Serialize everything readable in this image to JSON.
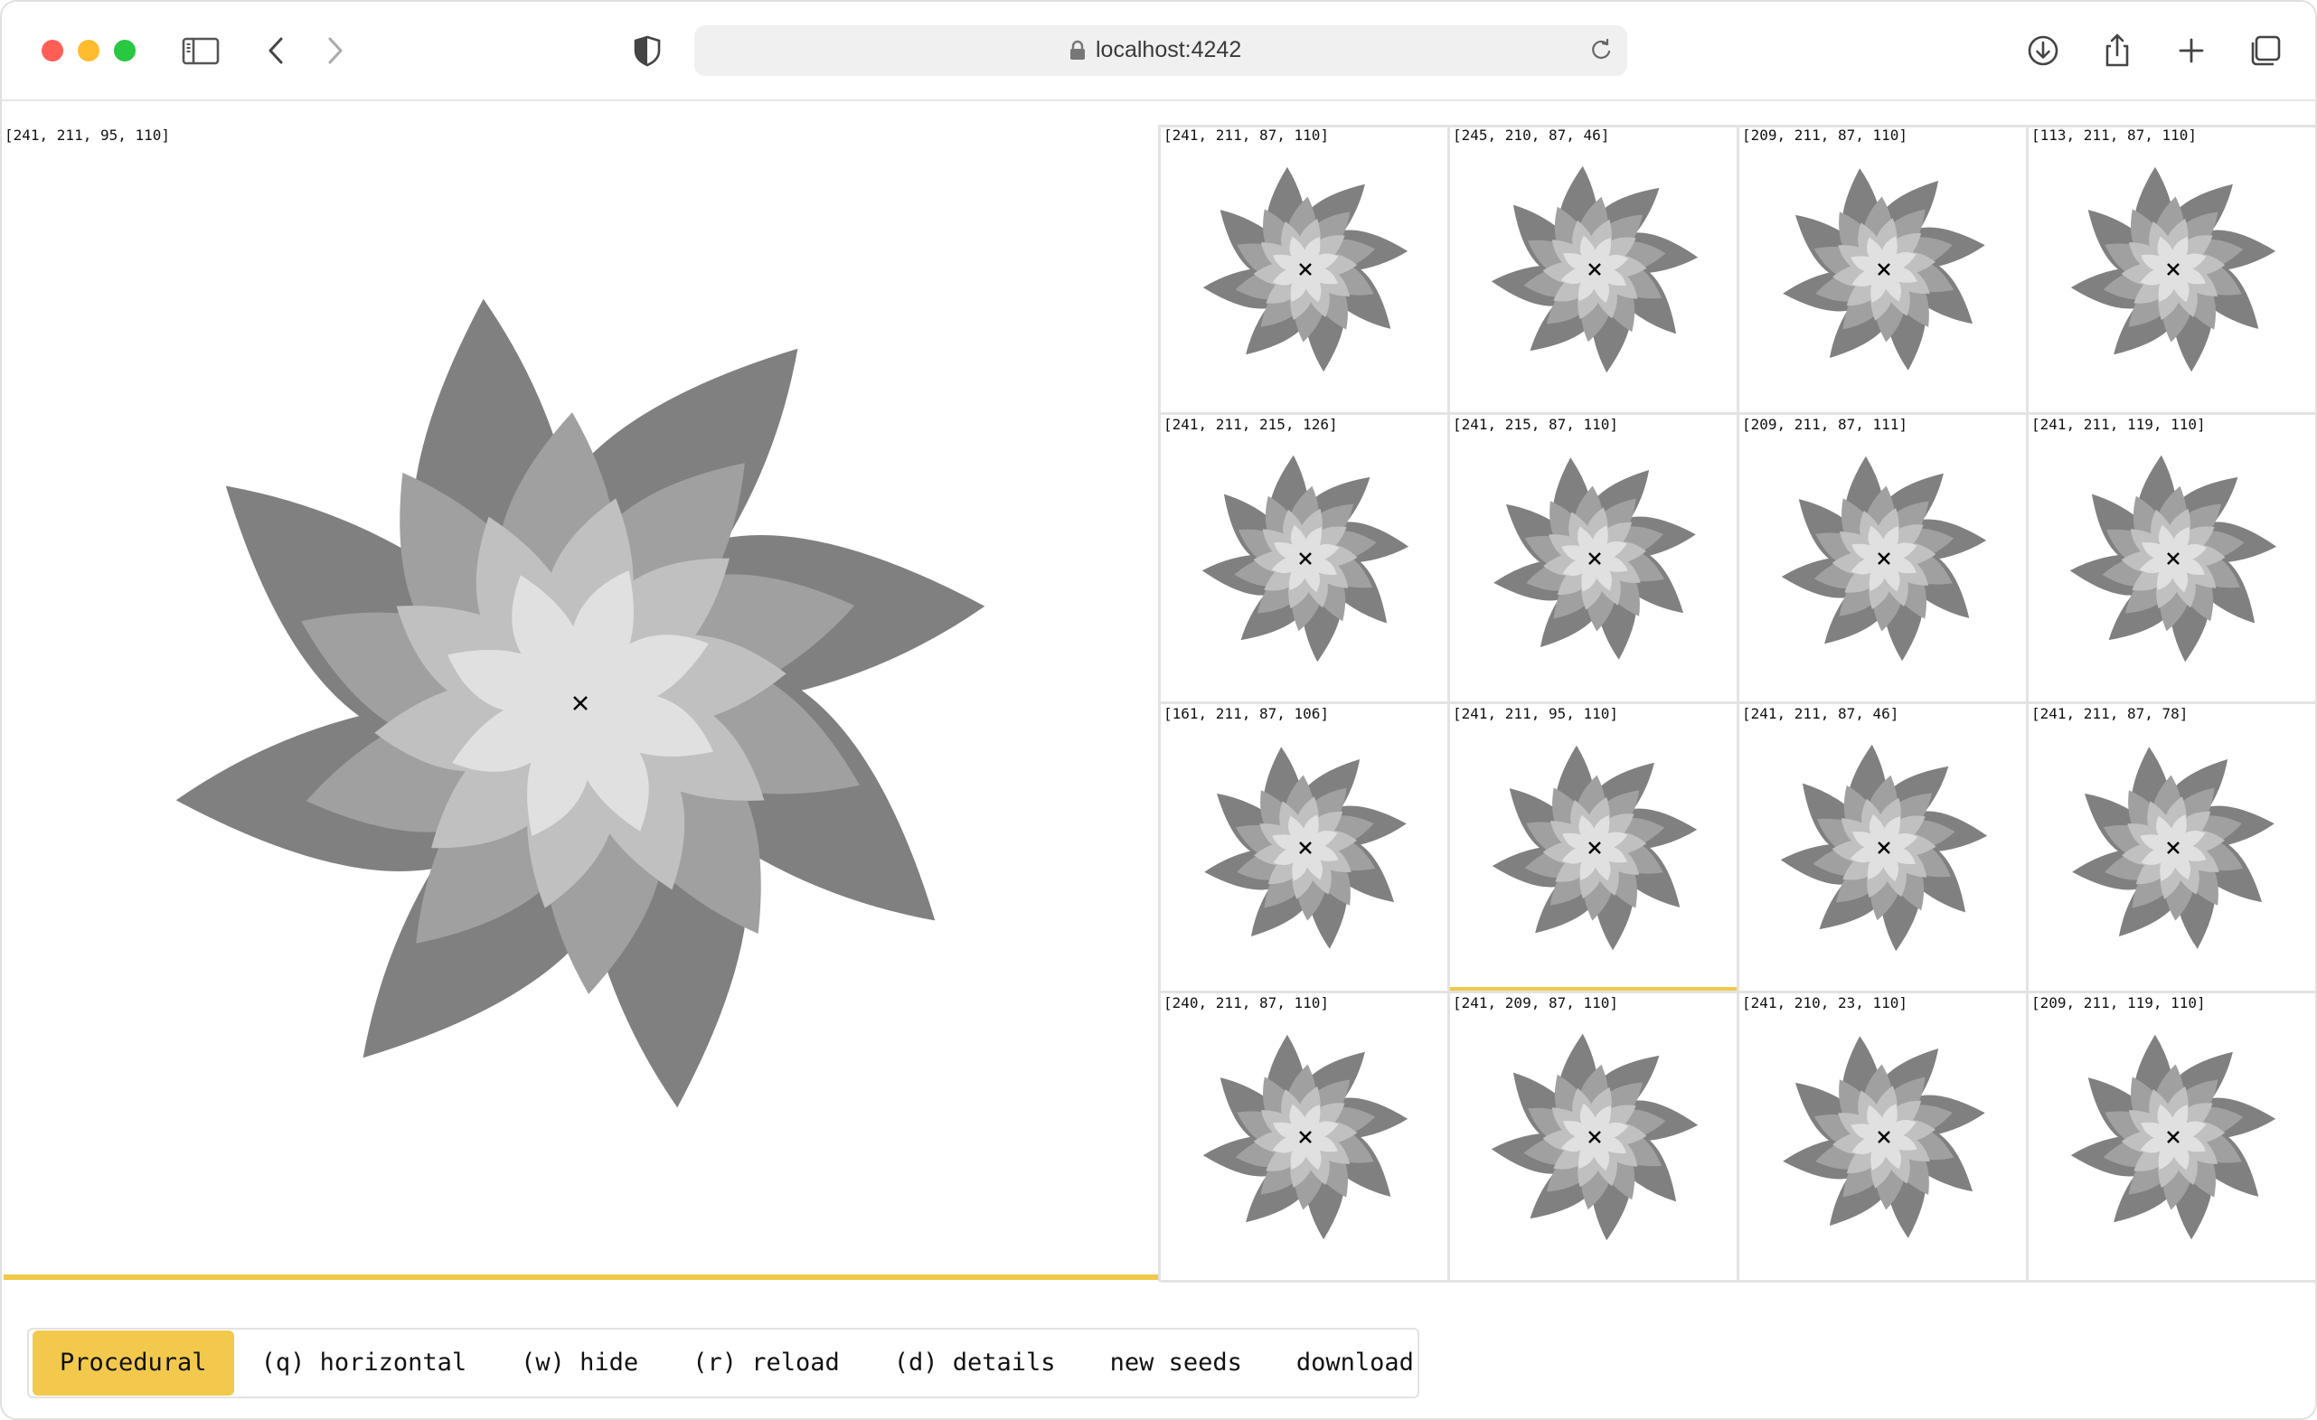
{
  "browser": {
    "url": "localhost:4242",
    "icons": [
      "sidebar-toggle-icon",
      "back-chevron-icon",
      "forward-chevron-icon",
      "shield-icon",
      "lock-icon",
      "reload-icon",
      "download-icon",
      "share-icon",
      "new-tab-plus-icon",
      "tabs-overview-icon"
    ]
  },
  "main_preview": {
    "label": "[241, 211, 95, 110]"
  },
  "grid": {
    "cells": [
      {
        "label": "[241, 211, 87, 110]"
      },
      {
        "label": "[245, 210, 87, 46]"
      },
      {
        "label": "[209, 211, 87, 110]"
      },
      {
        "label": "[113, 211, 87, 110]"
      },
      {
        "label": "[241, 211, 215, 126]"
      },
      {
        "label": "[241, 215, 87, 110]"
      },
      {
        "label": "[209, 211, 87, 111]"
      },
      {
        "label": "[241, 211, 119, 110]"
      },
      {
        "label": "[161, 211, 87, 106]"
      },
      {
        "label": "[241, 211, 95, 110]",
        "selected": true
      },
      {
        "label": "[241, 211, 87, 46]"
      },
      {
        "label": "[241, 211, 87, 78]"
      },
      {
        "label": "[240, 211, 87, 110]"
      },
      {
        "label": "[241, 209, 87, 110]"
      },
      {
        "label": "[241, 210, 23, 110]"
      },
      {
        "label": "[209, 211, 119, 110]"
      }
    ]
  },
  "buttons": {
    "procedural": "Procedural",
    "horizontal": "(q) horizontal",
    "hide": "(w) hide",
    "reload": "(r) reload",
    "details": "(d) details",
    "new_seeds": "new seeds",
    "download": "download"
  },
  "colors": {
    "accent": "#f2c94c",
    "petal_dark": "#808080",
    "petal_mid": "#a0a0a0",
    "petal_light": "#c0c0c0",
    "petal_lightest": "#e0e0e0"
  }
}
